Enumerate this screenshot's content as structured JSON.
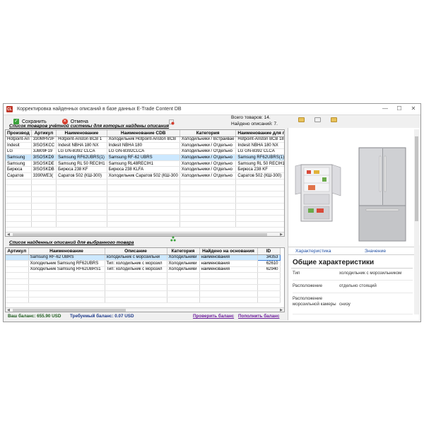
{
  "window": {
    "title": "Корректировка найденных описаний в базе данных E-Trade Content DB",
    "app_icon": "CL",
    "controls": [
      "—",
      "☐",
      "✕"
    ]
  },
  "toolbar": {
    "save_label": "Сохранить",
    "cancel_label": "Отмена"
  },
  "stats": {
    "total_items": "Всего товаров: 14.",
    "found_descriptions": "Найдено описаний: 7."
  },
  "goods_section": {
    "title": "Список товаров учётной системы для которых найдены описания",
    "columns": [
      "Производ",
      "Артикул",
      "Наименование",
      "Наименование CDB",
      "Категория",
      "Наименование для п"
    ],
    "rows": [
      [
        "Hotpoint-Ari",
        "330MHV3F",
        "Hotpoint-Ariston BCB 1",
        "Холодильник Hotpoint-Ariston BCB",
        "Холодильники / Встраивае",
        "Hotpoint-Ariston BCB 18"
      ],
      [
        "Indesit",
        "3ISOSKCC",
        "Indesit NBHA 180 NX",
        "Indesit NBHA 180",
        "Холодильники / Отдельно",
        "Indesit NBHA 180 NX"
      ],
      [
        "LG",
        "3JB09F19",
        "LG GN-B392 CLCA",
        "LG GN-B392CLCA",
        "Холодильники / Отдельно",
        "LG GN-B392 CLCA"
      ],
      [
        "Samsung",
        "3ISOSKD9",
        "Samsung RF62UBRS(1)",
        "Samsung RF-62 UBRS",
        "Холодильники / Отдельно",
        "Samsung RF62UBRS(1)"
      ],
      [
        "Samsung",
        "3ISOSKDE",
        "Samsung RL 50 RECIH1",
        "Samsung RL48RECIH1",
        "Холодильники / Отдельно",
        "Samsung RL 50 RECIH1"
      ],
      [
        "Бирюса",
        "3ISOSKDB",
        "Бирюса 238 KF",
        "Бирюса 238 KLFA",
        "Холодильники / Отдельно",
        "Бирюса 238 KF"
      ],
      [
        "Саратов",
        "3390WE3(",
        "Саратов 502 (КШ-300)",
        "Холодильник Саратов 502 (КШ-300",
        "Холодильники / Отдельно",
        "Саратов 502 (КШ-300)"
      ]
    ],
    "selected_row": 3
  },
  "desc_section": {
    "title": "Список найденных описаний для выбранного товара",
    "columns": [
      "Артикул",
      "Наименование",
      "Описание",
      "Категория",
      "Найдено на основания",
      "ID"
    ],
    "rows": [
      [
        "",
        "Samsung RF-62 UBRS",
        "холодильник с морозильни",
        "Холодильники",
        "наименования",
        "34353"
      ],
      [
        "",
        "Холодильник Samsung RF62UBRS",
        "Тип: холодильник с морозил",
        "Холодильники",
        "наименования",
        "62610"
      ],
      [
        "",
        "Холодильник Samsung RF62UBRS1",
        "Тип: холодильник с морозил",
        "Холодильники",
        "наименования",
        "62940"
      ]
    ],
    "selected_row": 0
  },
  "status": {
    "balance": "Ваш баланс:  655.90 USD",
    "required": "Требуемый баланс:   0.07 USD",
    "check_balance": "Проверить баланс",
    "top_up": "Пополнить баланс"
  },
  "details": {
    "tab_characteristic": "Характеристика",
    "tab_value": "Значение",
    "heading": "Общие характеристики",
    "rows": [
      {
        "key": "Тип",
        "value": "холодильник с морозильником"
      },
      {
        "key": "Расположение",
        "value": "отдельно стоящий"
      },
      {
        "key": "Расположение морозильной камеры",
        "value": "снизу"
      }
    ]
  }
}
